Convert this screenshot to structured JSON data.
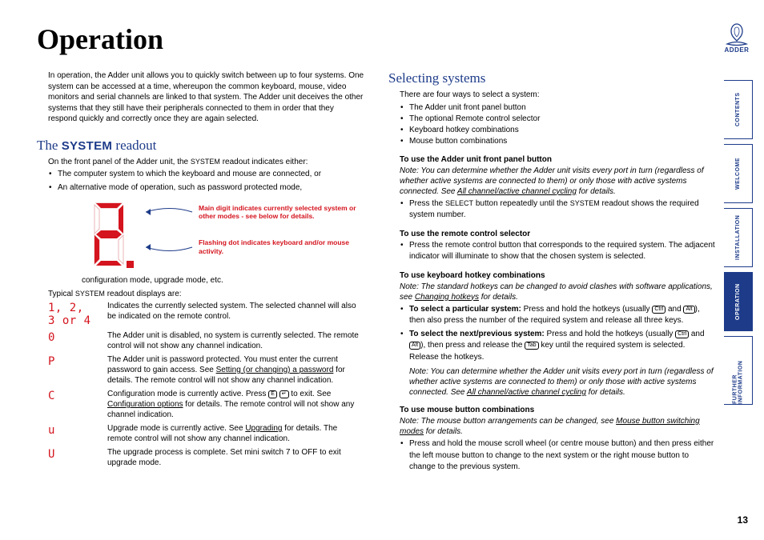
{
  "brand": "ADDER",
  "page_number": "13",
  "title": "Operation",
  "nav": [
    "CONTENTS",
    "WELCOME",
    "INSTALLATION",
    "OPERATION",
    "FURTHER INFORMATION"
  ],
  "nav_active_index": 3,
  "left": {
    "intro": "In operation, the Adder unit allows you to quickly switch between up to four systems. One system can be accessed at a time, whereupon the common keyboard, mouse, video monitors and serial channels are linked to that system. The Adder unit deceives the other systems that they still have their peripherals connected to them in order that they respond quickly and correctly once they are again selected.",
    "h2_pre": "The ",
    "h2_sc": "SYSTEM",
    "h2_post": " readout",
    "readout_intro_pre": "On the front panel of the Adder unit, the ",
    "readout_intro_sc": "SYSTEM",
    "readout_intro_post": " readout indicates either:",
    "readout_bullets": [
      "The computer system to which the keyboard and mouse are connected, or",
      "An alternative mode of operation, such as password protected mode,"
    ],
    "callout1": "Main digit indicates currently selected system or other modes - see below for details.",
    "callout2": "Flashing dot indicates keyboard and/or mouse activity.",
    "after_diagram": "configuration mode, upgrade mode, etc.",
    "typical_pre": "Typical ",
    "typical_sc": "SYSTEM",
    "typical_post": " readout displays are:",
    "rows": [
      {
        "label": "1, 2, 3 or 4",
        "desc_pre": "Indicates the currently selected system. The selected channel will also be indicated on the remote control.",
        "link": "",
        "desc_post": ""
      },
      {
        "label": "0",
        "desc_pre": "The Adder unit is disabled, no system is currently selected. The remote control will not show any channel indication.",
        "link": "",
        "desc_post": ""
      },
      {
        "label": "P",
        "desc_pre": "The Adder unit is password protected. You must enter the current password to gain access. See ",
        "link": "Setting (or changing) a password",
        "desc_post": " for details. The remote control will not show any channel indication."
      },
      {
        "label": "C",
        "desc_pre": "Configuration mode is currently active. Press ",
        "link": "Configuration options",
        "desc_post": " for details. The remote control will not show any channel indication.",
        "keys": true
      },
      {
        "label": "u",
        "desc_pre": "Upgrade mode is currently active. See ",
        "link": "Upgrading",
        "desc_post": " for details. The remote control will not show any channel indication."
      },
      {
        "label": "U",
        "desc_pre": "The upgrade process is complete. Set mini switch 7 to OFF to exit upgrade mode.",
        "link": "",
        "desc_post": ""
      }
    ]
  },
  "right": {
    "h2": "Selecting systems",
    "intro": "There are four ways to select a system:",
    "ways": [
      "The Adder unit front panel button",
      "The optional Remote control selector",
      "Keyboard hotkey combinations",
      "Mouse button combinations"
    ],
    "sec1_head": "To use the Adder unit front panel button",
    "sec1_note_pre": "Note: You can determine whether the Adder unit visits every port in turn (regardless of whether active systems are connected to them) or only those with active systems connected. See ",
    "sec1_note_link": "All channel/active channel cycling",
    "sec1_note_post": " for details.",
    "sec1_bullet_pre": "Press the ",
    "sec1_bullet_sc": "SELECT",
    "sec1_bullet_mid": " button repeatedly until the ",
    "sec1_bullet_sc2": "SYSTEM",
    "sec1_bullet_post": " readout shows the required system number.",
    "sec2_head": "To use the remote control selector",
    "sec2_bullet": "Press the remote control button that corresponds to the required system. The adjacent indicator will illuminate to show that the chosen system is selected.",
    "sec3_head": "To use keyboard hotkey combinations",
    "sec3_note_pre": "Note: The standard hotkeys can be changed to avoid clashes with software applications, see ",
    "sec3_note_link": "Changing hotkeys",
    "sec3_note_post": " for details.",
    "sec3_b1_strong": "To select a particular system: ",
    "sec3_b1_pre": "Press and hold the hotkeys (usually ",
    "sec3_b1_mid": " and ",
    "sec3_b1_post": "), then also press the number of the required system and release all three keys.",
    "sec3_b2_strong": "To select the next/previous system: ",
    "sec3_b2_pre": "Press and hold the hotkeys (usually ",
    "sec3_b2_mid1": " and ",
    "sec3_b2_mid2": "), then press and release the ",
    "sec3_b2_post": " key until the required system is selected. Release the hotkeys.",
    "sec3_inner_note_pre": "Note: You can determine whether the Adder unit visits every port in turn (regardless of whether active systems are connected to them) or only those with active systems connected. See ",
    "sec3_inner_note_link": "All channel/active channel cycling",
    "sec3_inner_note_post": " for details.",
    "sec4_head": "To use mouse button combinations",
    "sec4_note_pre": "Note: The mouse button arrangements can be changed, see ",
    "sec4_note_link": "Mouse button switching modes",
    "sec4_note_post": " for details.",
    "sec4_bullet": "Press and hold the mouse scroll wheel (or centre mouse button) and then press either the left mouse button to change to the next system or the right mouse button to change to the previous system.",
    "keys": {
      "ctrl": "Ctrl",
      "alt": "Alt",
      "tab": "Tab",
      "e": "E",
      "enter": "↵"
    }
  }
}
